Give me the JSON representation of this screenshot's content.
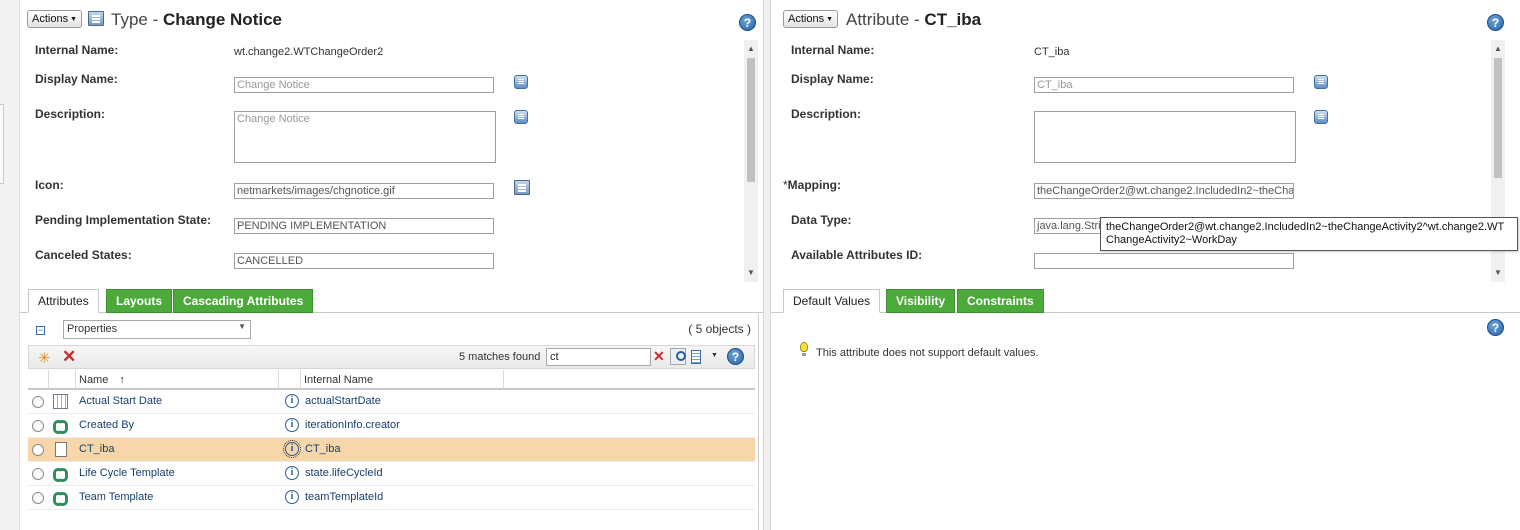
{
  "left_panel": {
    "actions_label": "Actions",
    "title_prefix": "Type - ",
    "title_bold": "Change Notice",
    "help": "?",
    "fields": {
      "internal_name_label": "Internal Name:",
      "internal_name_value": "wt.change2.WTChangeOrder2",
      "display_name_label": "Display Name:",
      "display_name_value": "Change Notice",
      "description_label": "Description:",
      "description_value": "Change Notice",
      "icon_label": "Icon:",
      "icon_value": "netmarkets/images/chgnotice.gif",
      "pending_label": "Pending Implementation State:",
      "pending_value": "PENDING IMPLEMENTATION",
      "canceled_label": "Canceled States:",
      "canceled_value": "CANCELLED"
    },
    "tabs": [
      {
        "label": "Attributes",
        "active": true
      },
      {
        "label": "Layouts",
        "active": false
      },
      {
        "label": "Cascading Attributes",
        "active": false
      }
    ],
    "table": {
      "view_select": "Properties",
      "object_count": "( 5 objects )",
      "matches": "5 matches found",
      "search_value": "ct",
      "columns": [
        "Name",
        "Internal Name"
      ],
      "sort_indicator": "↑",
      "rows": [
        {
          "name": "Actual Start Date",
          "internal": "actualStartDate",
          "icon": "calendar-icon"
        },
        {
          "name": "Created By",
          "internal": "iterationInfo.creator",
          "icon": "reference-icon"
        },
        {
          "name": "CT_iba",
          "internal": "CT_iba",
          "icon": "document-icon",
          "selected": true
        },
        {
          "name": "Life Cycle Template",
          "internal": "state.lifeCycleId",
          "icon": "reference-icon"
        },
        {
          "name": "Team Template",
          "internal": "teamTemplateId",
          "icon": "reference-icon"
        }
      ]
    }
  },
  "right_panel": {
    "actions_label": "Actions",
    "title_prefix": "Attribute - ",
    "title_bold": "CT_iba",
    "help": "?",
    "fields": {
      "internal_name_label": "Internal Name:",
      "internal_name_value": "CT_iba",
      "display_name_label": "Display Name:",
      "display_name_value": "CT_iba",
      "description_label": "Description:",
      "description_value": "",
      "mapping_required": "*",
      "mapping_label": "Mapping:",
      "mapping_value": "theChangeOrder2@wt.change2.IncludedIn2~theCha",
      "data_type_label": "Data Type:",
      "data_type_value": "java.lang.Strin",
      "available_label": "Available Attributes ID:",
      "available_value": ""
    },
    "tabs": [
      {
        "label": "Default Values",
        "active": true
      },
      {
        "label": "Visibility",
        "active": false
      },
      {
        "label": "Constraints",
        "active": false
      }
    ],
    "note": "This attribute does not support default values.",
    "tooltip": "theChangeOrder2@wt.change2.IncludedIn2~theChangeActivity2^wt.change2.WTChangeActivity2~WorkDay"
  },
  "colors": {
    "tab_green": "#4caa3b",
    "selected_row": "#f7d7aa",
    "link_blue": "#173f6b"
  }
}
